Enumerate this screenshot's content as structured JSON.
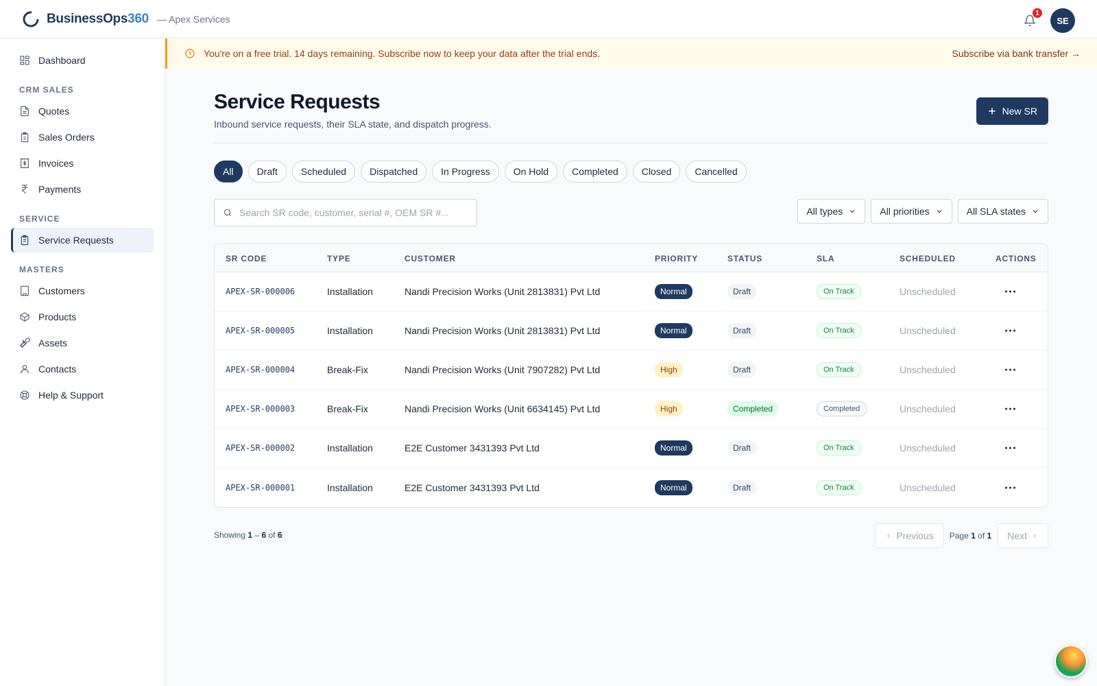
{
  "header": {
    "brand_main": "BusinessOps",
    "brand_num": "360",
    "tenant": "— Apex Services",
    "notification_count": "1",
    "avatar_initials": "SE"
  },
  "sidebar": {
    "dashboard": "Dashboard",
    "section_crm": "CRM SALES",
    "quotes": "Quotes",
    "sales_orders": "Sales Orders",
    "invoices": "Invoices",
    "payments": "Payments",
    "section_service": "SERVICE",
    "service_requests": "Service Requests",
    "section_masters": "MASTERS",
    "customers": "Customers",
    "products": "Products",
    "assets": "Assets",
    "contacts": "Contacts",
    "help": "Help & Support"
  },
  "banner": {
    "text": "You're on a free trial. 14 days remaining. Subscribe now to keep your data after the trial ends.",
    "link": "Subscribe via bank transfer →"
  },
  "page": {
    "title": "Service Requests",
    "subtitle": "Inbound service requests, their SLA state, and dispatch progress.",
    "new_button": "New SR"
  },
  "tabs": [
    "All",
    "Draft",
    "Scheduled",
    "Dispatched",
    "In Progress",
    "On Hold",
    "Completed",
    "Closed",
    "Cancelled"
  ],
  "search": {
    "placeholder": "Search SR code, customer, serial #, OEM SR #..."
  },
  "filters": {
    "types": "All types",
    "priorities": "All priorities",
    "sla": "All SLA states"
  },
  "table": {
    "columns": [
      "SR CODE",
      "TYPE",
      "CUSTOMER",
      "PRIORITY",
      "STATUS",
      "SLA",
      "SCHEDULED",
      "ACTIONS"
    ],
    "rows": [
      {
        "code": "APEX-SR-000006",
        "type": "Installation",
        "customer": "Nandi Precision Works (Unit 2813831) Pvt Ltd",
        "priority": "Normal",
        "status": "Draft",
        "sla": "On Track",
        "scheduled": "Unscheduled"
      },
      {
        "code": "APEX-SR-000005",
        "type": "Installation",
        "customer": "Nandi Precision Works (Unit 2813831) Pvt Ltd",
        "priority": "Normal",
        "status": "Draft",
        "sla": "On Track",
        "scheduled": "Unscheduled"
      },
      {
        "code": "APEX-SR-000004",
        "type": "Break-Fix",
        "customer": "Nandi Precision Works (Unit 7907282) Pvt Ltd",
        "priority": "High",
        "status": "Draft",
        "sla": "On Track",
        "scheduled": "Unscheduled"
      },
      {
        "code": "APEX-SR-000003",
        "type": "Break-Fix",
        "customer": "Nandi Precision Works (Unit 6634145) Pvt Ltd",
        "priority": "High",
        "status": "Completed",
        "sla": "Completed",
        "scheduled": "Unscheduled"
      },
      {
        "code": "APEX-SR-000002",
        "type": "Installation",
        "customer": "E2E Customer 3431393 Pvt Ltd",
        "priority": "Normal",
        "status": "Draft",
        "sla": "On Track",
        "scheduled": "Unscheduled"
      },
      {
        "code": "APEX-SR-000001",
        "type": "Installation",
        "customer": "E2E Customer 3431393 Pvt Ltd",
        "priority": "Normal",
        "status": "Draft",
        "sla": "On Track",
        "scheduled": "Unscheduled"
      }
    ]
  },
  "footer": {
    "showing_prefix": "Showing",
    "range_start": "1",
    "range_sep": "–",
    "range_end": "6",
    "of": "of",
    "total": "6",
    "previous": "Previous",
    "next": "Next",
    "page_word": "Page",
    "page_current": "1",
    "page_of": "of",
    "page_total": "1"
  }
}
